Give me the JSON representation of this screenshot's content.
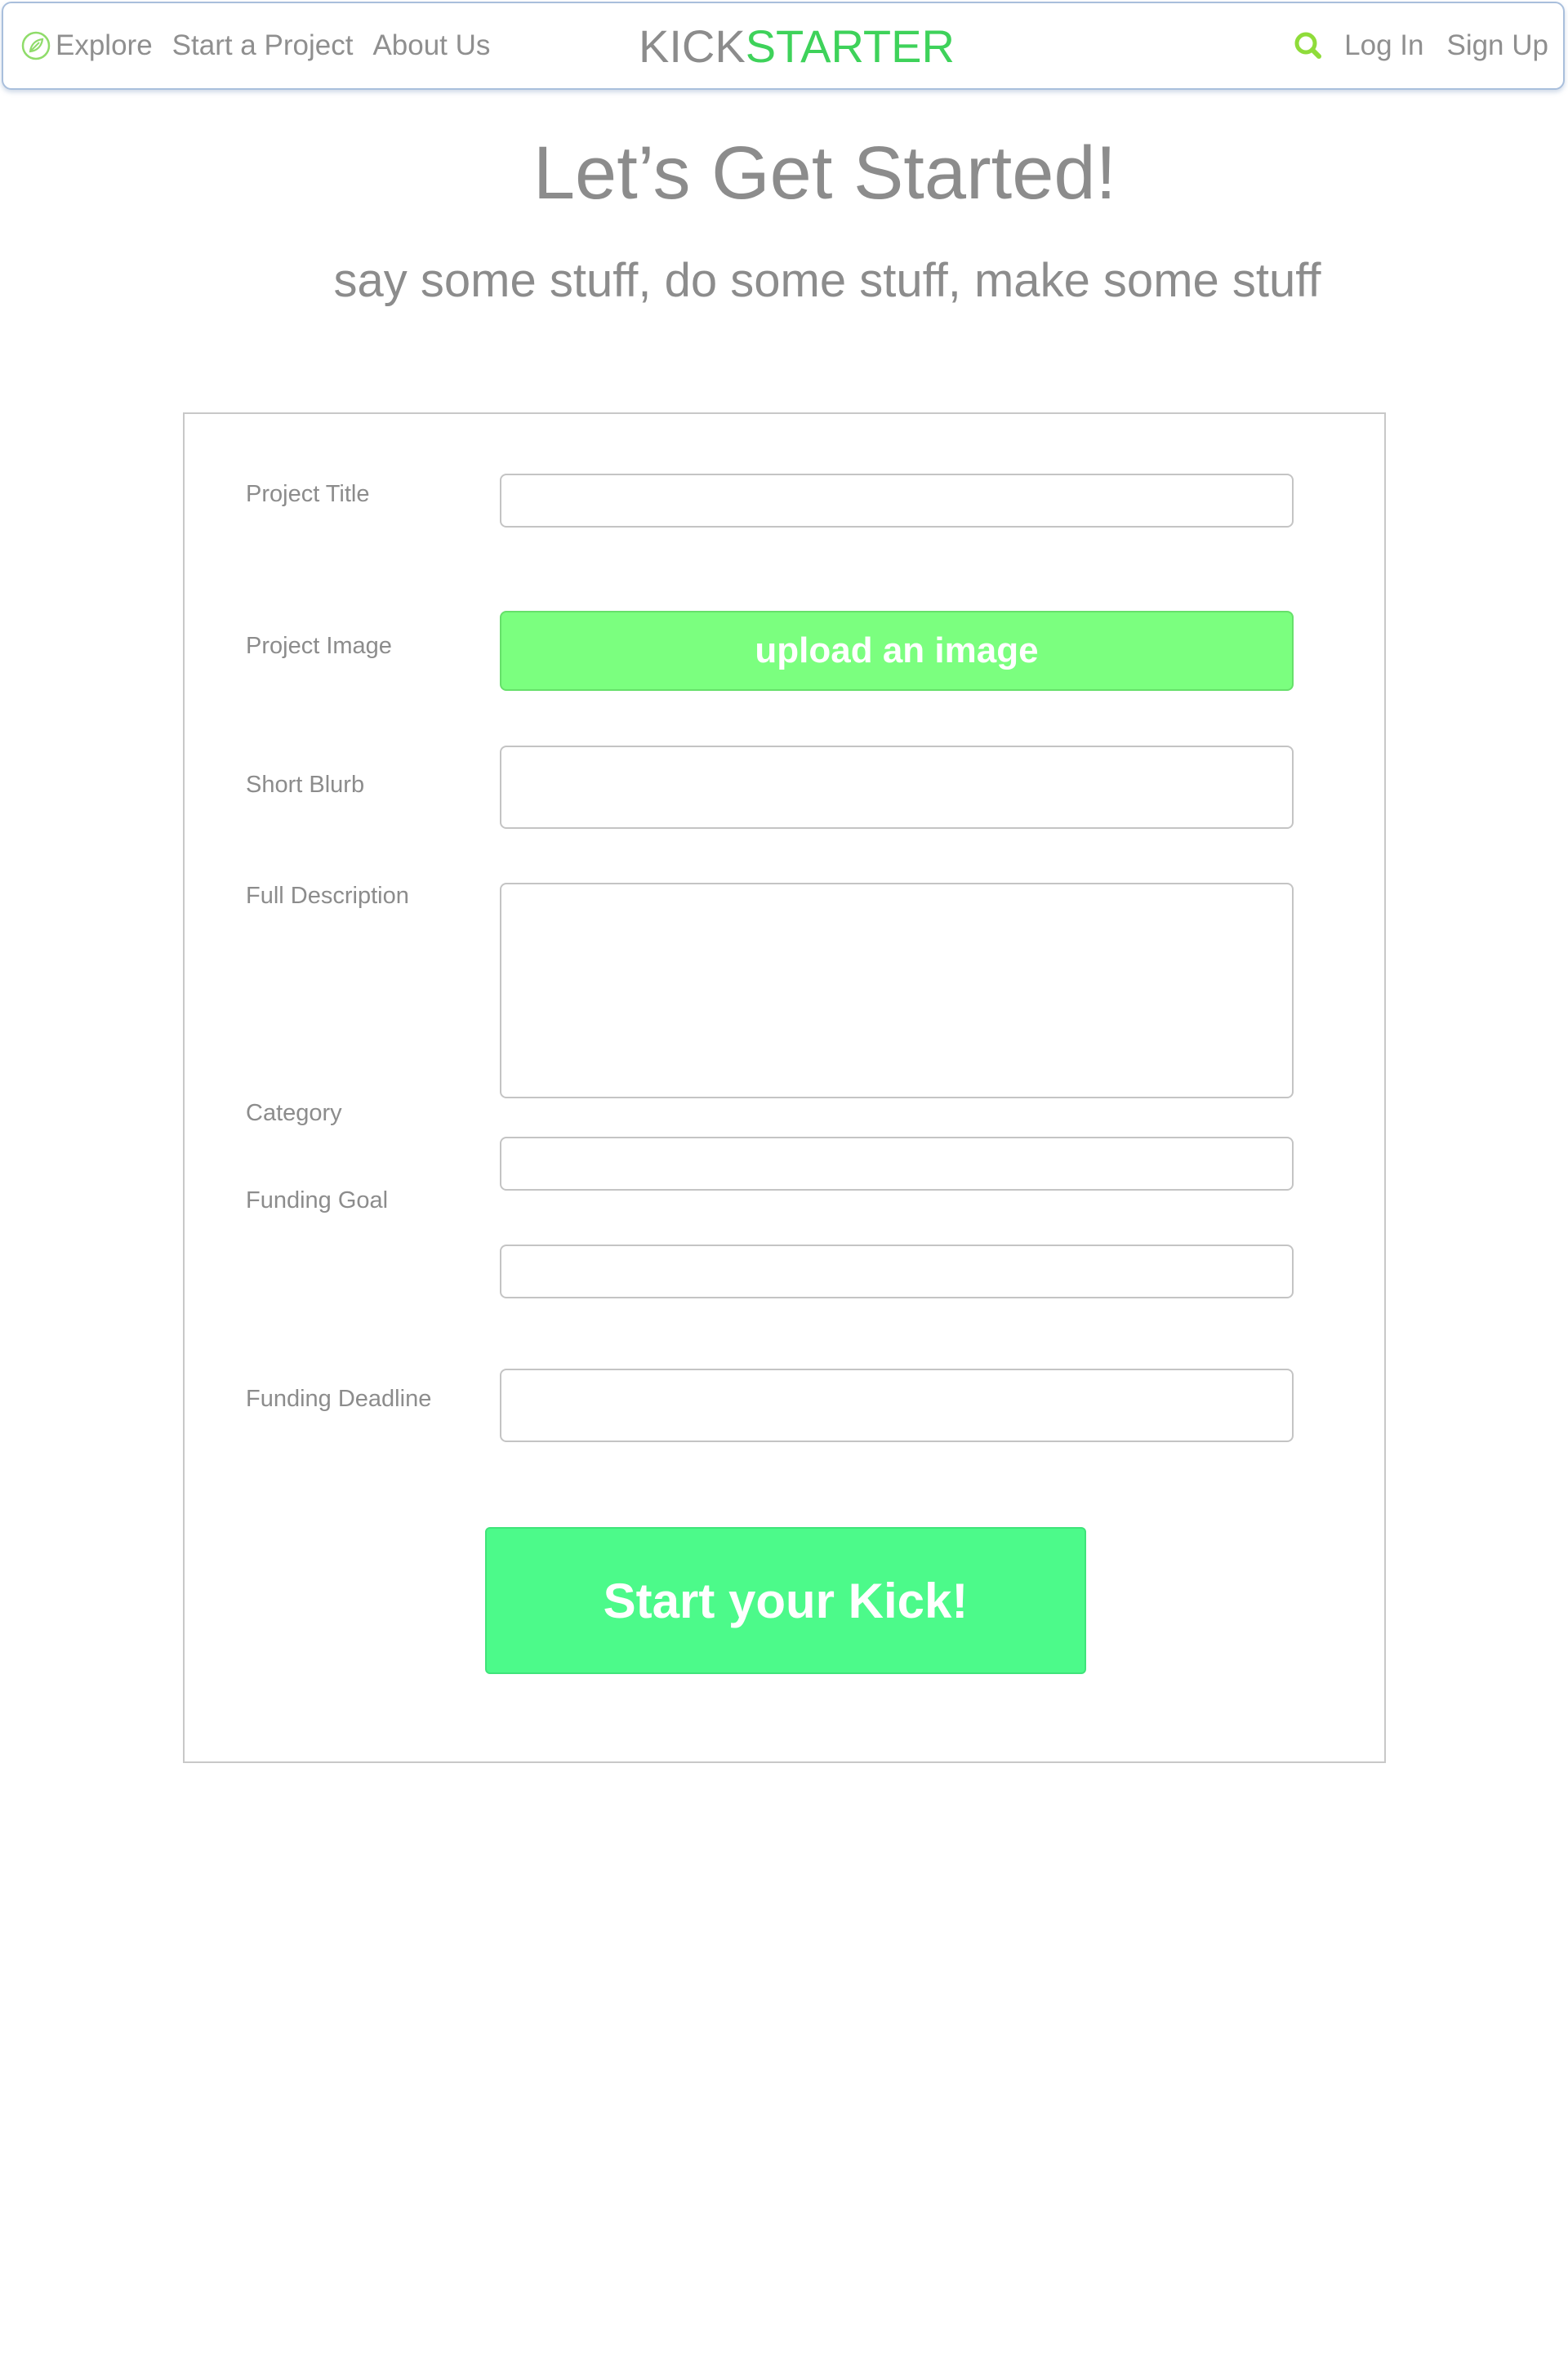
{
  "nav": {
    "explore_label": "Explore",
    "start_project_label": "Start a Project",
    "about_label": "About Us",
    "logo_left": "KICK",
    "logo_right": "STARTER",
    "login_label": "Log In",
    "signup_label": "Sign Up",
    "explore_icon": "compass-leaf-icon",
    "search_icon": "search-icon"
  },
  "hero": {
    "title": "Let’s Get Started!",
    "subtitle": "say some stuff, do some stuff, make some stuff"
  },
  "form": {
    "project_title": {
      "label": "Project Title",
      "value": ""
    },
    "project_image": {
      "label": "Project Image",
      "button_label": "upload an image"
    },
    "short_blurb": {
      "label": "Short Blurb",
      "value": ""
    },
    "full_description": {
      "label": "Full Description",
      "value": ""
    },
    "category": {
      "label": "Category",
      "value": ""
    },
    "funding_goal": {
      "label": "Funding Goal",
      "value": ""
    },
    "funding_deadline": {
      "label": "Funding Deadline",
      "value": ""
    },
    "submit_label": "Start your Kick!"
  },
  "colors": {
    "brand_green": "#3ed25a",
    "upload_green": "#7bff7f",
    "submit_green": "#4cfa8a",
    "text_gray": "#8c8c8c",
    "nav_border": "#a9bfdc"
  }
}
